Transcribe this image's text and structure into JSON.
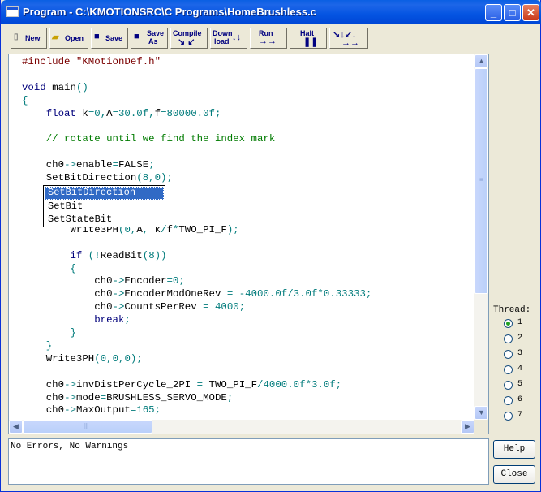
{
  "window": {
    "title": "Program - C:\\KMOTIONSRC\\C Programs\\HomeBrushless.c"
  },
  "title_buttons": {
    "minimize": "_",
    "maximize": "□",
    "close": "✕"
  },
  "toolbar": {
    "new": "New",
    "open": "Open",
    "save": "Save",
    "save_as_1": "Save",
    "save_as_2": "As",
    "compile": "Compile",
    "download_1": "Down",
    "download_2": "load",
    "run": "Run",
    "halt": "Halt"
  },
  "editor": {
    "lines": [
      "#include \"KMotionDef.h\"",
      "",
      "void main()",
      "{",
      "    float k=0,A=30.0f,f=80000.0f;",
      "",
      "    // rotate until we find the index mark",
      "",
      "    ch0->enable=FALSE;",
      "    SetBitDirection(8,0);",
      "",
      "",
      "                     f;",
      "        Write3PH(0,A, k/f*TWO_PI_F);",
      "",
      "        if (!ReadBit(8))",
      "        {",
      "            ch0->Encoder=0;",
      "            ch0->EncoderModOneRev = -4000.0f/3.0f*0.33333;",
      "            ch0->CountsPerRev = 4000;",
      "            break;",
      "        }",
      "    }",
      "    Write3PH(0,0,0);",
      "",
      "    ch0->invDistPerCycle_2PI = TWO_PI_F/4000.0f*3.0f;",
      "    ch0->mode=BRUSHLESS_SERVO_MODE;",
      "    ch0->MaxOutput=165;"
    ]
  },
  "autocomplete": {
    "items": [
      "SetBitDirection",
      "SetBit",
      "SetStateBit"
    ]
  },
  "thread": {
    "title": "Thread:",
    "options": [
      "1",
      "2",
      "3",
      "4",
      "5",
      "6",
      "7"
    ],
    "selected": "1"
  },
  "output": {
    "text": "No Errors, No Warnings"
  },
  "buttons": {
    "help": "Help",
    "close": "Close"
  }
}
